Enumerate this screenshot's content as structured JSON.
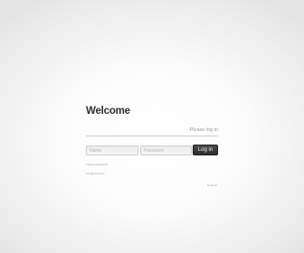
{
  "login": {
    "title": "Welcome",
    "subtitle": "Please log in",
    "username": {
      "placeholder": "Name",
      "value": ""
    },
    "password": {
      "placeholder": "Password",
      "value": ""
    },
    "login_button_label": "Log in",
    "forgot_link_label": "Forgot password?",
    "second_link_label": "Create Account",
    "language_link_label": "Deutsch"
  }
}
